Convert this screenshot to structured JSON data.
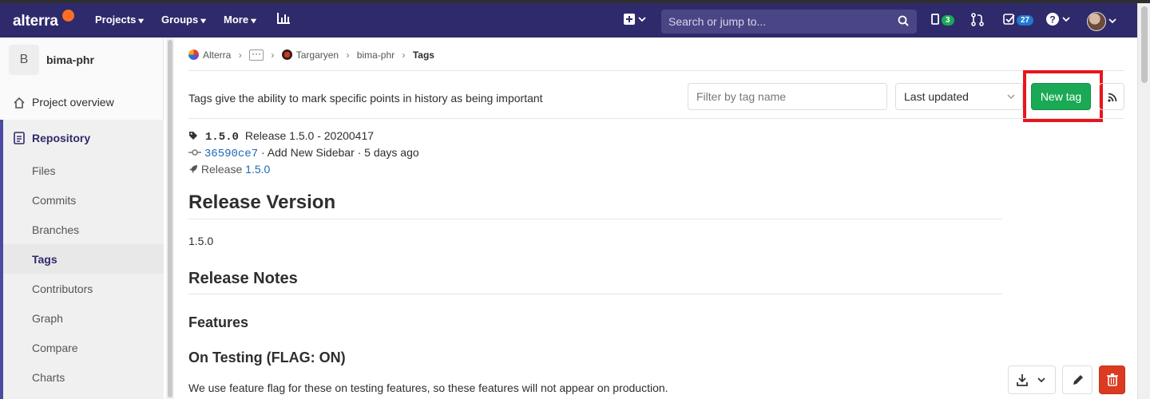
{
  "navbar": {
    "logo": "alterra",
    "projects": "Projects",
    "groups": "Groups",
    "more": "More",
    "search_placeholder": "Search or jump to...",
    "issues_count": "3",
    "todos_count": "27"
  },
  "sidebar": {
    "project_initial": "B",
    "project_name": "bima-phr",
    "overview": "Project overview",
    "repository": "Repository",
    "items": [
      "Files",
      "Commits",
      "Branches",
      "Tags",
      "Contributors",
      "Graph",
      "Compare",
      "Charts"
    ],
    "active_item": "Tags"
  },
  "breadcrumb": {
    "group": "Alterra",
    "subgroup": "Targaryen",
    "project": "bima-phr",
    "current": "Tags"
  },
  "tags_page": {
    "intro": "Tags give the ability to mark specific points in history as being important",
    "filter_placeholder": "Filter by tag name",
    "sort_value": "Last updated",
    "new_tag_label": "New tag"
  },
  "tag": {
    "name": "1.5.0",
    "message": "Release 1.5.0 - 20200417",
    "commit_sha": "36590ce7",
    "commit_title": "· Add New Sidebar · 5 days ago",
    "release_prefix": "Release",
    "release_link": "1.5.0",
    "heading_version": "Release Version",
    "version_text": "1.5.0",
    "heading_notes": "Release Notes",
    "heading_features": "Features",
    "heading_testing": "On Testing (FLAG: ON)",
    "testing_text": "We use feature flag for these on testing features, so these features will not appear on production."
  },
  "colors": {
    "navbar": "#2f2a6b",
    "new_tag_button": "#1aaa55",
    "highlight_box": "#e8161c",
    "delete_button": "#db3b21",
    "link": "#1b69b6"
  }
}
